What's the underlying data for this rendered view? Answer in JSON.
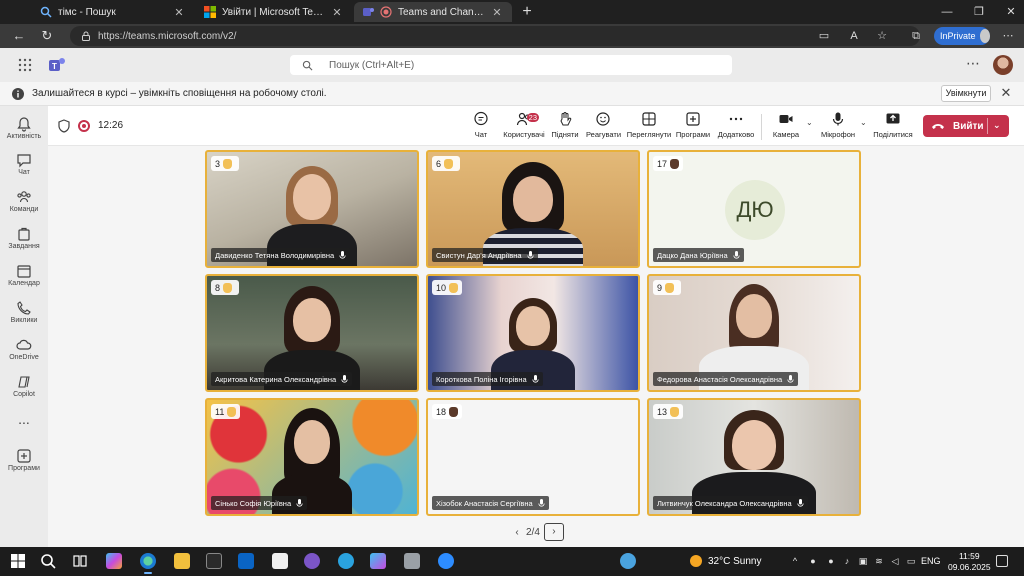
{
  "browser": {
    "tabs": [
      {
        "title": "тімс - Пошук",
        "active": false
      },
      {
        "title": "Увійти | Microsoft Teams",
        "active": false
      },
      {
        "title": "Teams and Channels | Заняття",
        "active": true
      }
    ],
    "url": "https://teams.microsoft.com/v2/",
    "inprivate_label": "InPrivate"
  },
  "teams": {
    "search_placeholder": "Пошук (Ctrl+Alt+E)",
    "notification": {
      "text": "Залишайтеся в курсі – увімкніть сповіщення на робочому столі.",
      "button": "Увімкнути"
    },
    "rail": [
      {
        "label": "Активність",
        "icon": "bell-icon"
      },
      {
        "label": "Чат",
        "icon": "chat-icon"
      },
      {
        "label": "Команди",
        "icon": "teams-icon"
      },
      {
        "label": "Завдання",
        "icon": "assignments-icon"
      },
      {
        "label": "Календар",
        "icon": "calendar-icon"
      },
      {
        "label": "Виклики",
        "icon": "phone-icon"
      },
      {
        "label": "OneDrive",
        "icon": "cloud-icon"
      },
      {
        "label": "Copilot",
        "icon": "copilot-icon"
      },
      {
        "label": "...",
        "icon": "more-icon"
      },
      {
        "label": "Програми",
        "icon": "apps-icon"
      }
    ]
  },
  "meeting": {
    "time": "12:26",
    "toolbar": {
      "chat": "Чат",
      "people": "Користувачі",
      "people_badge": "23",
      "raise": "Підняти",
      "react": "Реагувати",
      "view": "Переглянути",
      "apps": "Програми",
      "more": "Додатково",
      "camera": "Камера",
      "mic": "Мікрофон",
      "share": "Поділитися",
      "leave": "Вийти"
    },
    "tiles": [
      {
        "order": "3",
        "name": "Давиденко Тетяна Володимирівна",
        "hand_color": "#f2c057"
      },
      {
        "order": "6",
        "name": "Свистун Дар'я Андріївна",
        "hand_color": "#f2c057"
      },
      {
        "order": "17",
        "name": "Дацко Дана Юріївна",
        "initials": "ДЮ",
        "hand_color": "#5b3a2a"
      },
      {
        "order": "8",
        "name": "Акритова Катерина Олександрівна",
        "hand_color": "#f2c057"
      },
      {
        "order": "10",
        "name": "Короткова Поліна Ігорівна",
        "hand_color": "#f2c057"
      },
      {
        "order": "9",
        "name": "Федорова Анастасія Олександрівна",
        "hand_color": "#f2c057"
      },
      {
        "order": "11",
        "name": "Сінько Софія Юріївна",
        "hand_color": "#f2c057"
      },
      {
        "order": "18",
        "name": "Хізобок Анастасія Сергіївна",
        "hand_color": "#5b3a2a"
      },
      {
        "order": "13",
        "name": "Литвинчук Олександра Олександрівна",
        "hand_color": "#f2c057"
      }
    ],
    "pager": "2/4"
  },
  "taskbar": {
    "weather": "32°C  Sunny",
    "lang": "ENG",
    "time": "11:59",
    "date": "09.06.2025"
  },
  "colors": {
    "accent": "#5b5fc7",
    "tile_border": "#e8b13a",
    "leave": "#c4314b"
  }
}
